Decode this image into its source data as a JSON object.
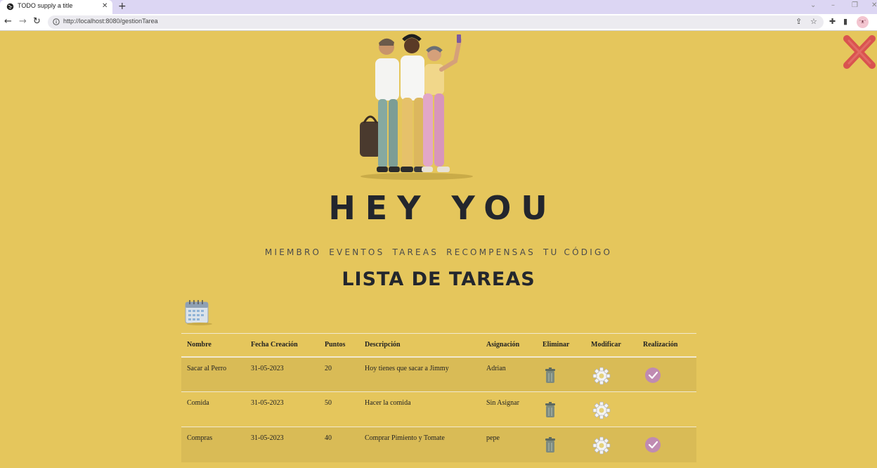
{
  "browser": {
    "tab_title": "TODO supply a title",
    "url": "http://localhost:8080/gestionTarea",
    "profile_initials": "ᵔᴥᵔ"
  },
  "page": {
    "title": "HEY YOU",
    "nav": [
      "MIEMBRO",
      "EVENTOS",
      "TAREAS",
      "RECOMPENSAS",
      "TU CÓDIGO"
    ],
    "list_title": "LISTA DE TAREAS"
  },
  "table": {
    "headers": [
      "Nombre",
      "Fecha Creación",
      "Puntos",
      "Descripción",
      "Asignación",
      "Eliminar",
      "Modificar",
      "Realización"
    ],
    "rows": [
      {
        "nombre": "Sacar al Perro",
        "fecha": "31-05-2023",
        "puntos": "20",
        "descripcion": "Hoy tienes que sacar a Jimmy",
        "asignacion": "Adrian",
        "completable": true
      },
      {
        "nombre": "Comida",
        "fecha": "31-05-2023",
        "puntos": "50",
        "descripcion": "Hacer la comida",
        "asignacion": "Sin Asignar",
        "completable": false
      },
      {
        "nombre": "Compras",
        "fecha": "31-05-2023",
        "puntos": "40",
        "descripcion": "Comprar Pimiento y Tomate",
        "asignacion": "pepe",
        "completable": true
      }
    ]
  },
  "icons": {
    "close": "close-x-icon",
    "calendar": "calendar-icon",
    "delete": "trash-icon",
    "modify": "gear-icon",
    "complete": "check-icon"
  },
  "colors": {
    "background": "#e5c65c",
    "row_alt": "#d9bb56",
    "heading": "#23262d",
    "close_x": "#d9534f",
    "check": "#c08bb2"
  }
}
